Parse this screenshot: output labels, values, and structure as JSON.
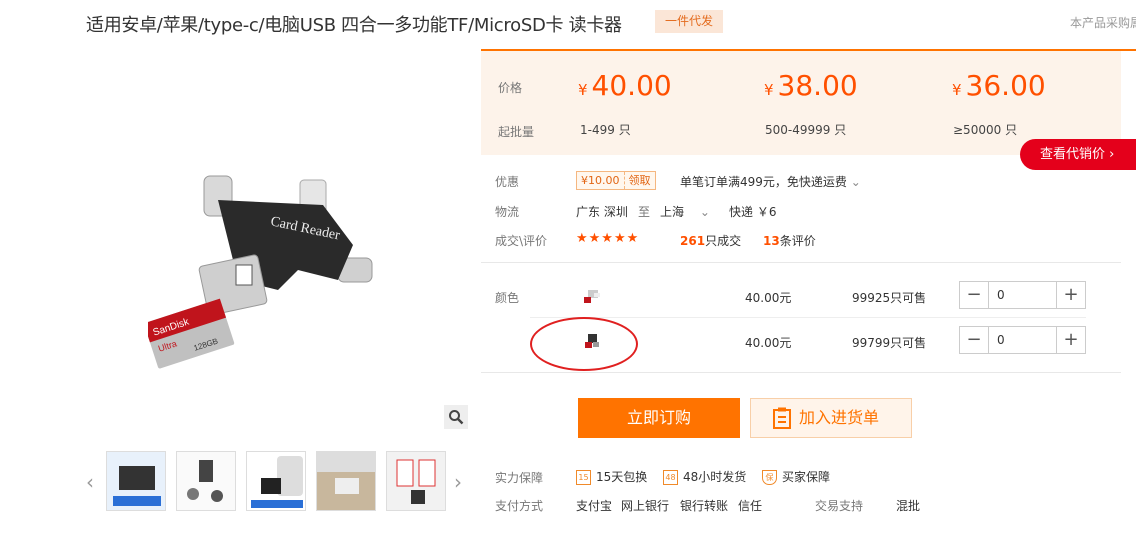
{
  "header": {
    "title": "适用安卓/苹果/type-c/电脑USB 四合一多功能TF/MicroSD卡 读卡器",
    "badge": "一件代发",
    "top_right": "本产品采购属"
  },
  "pricing": {
    "price_label": "价格",
    "moq_label": "起批量",
    "currency": "¥",
    "tiers": [
      {
        "price": "40.00",
        "range": "1-499",
        "unit": "只"
      },
      {
        "price": "38.00",
        "range": "500-49999",
        "unit": "只"
      },
      {
        "price": "36.00",
        "range": "≥50000",
        "unit": "只"
      }
    ],
    "agent_button": "查看代销价"
  },
  "info": {
    "discount_label": "优惠",
    "coupon_amount": "¥10.00",
    "coupon_action": "领取",
    "discount_text": "单笔订单满499元，免快递运费",
    "logistics_label": "物流",
    "from": "广东 深圳",
    "to_word": "至",
    "to": "上海",
    "shipping": "快递 ￥6",
    "review_label": "成交\\评价",
    "stars": "★★★★★",
    "deals_count": "261",
    "deals_text": "只成交",
    "review_count": "13",
    "review_text": "条评价"
  },
  "sku": {
    "color_label": "颜色",
    "items": [
      {
        "price": "40.00元",
        "stock": "99925只可售",
        "qty": "0"
      },
      {
        "price": "40.00元",
        "stock": "99799只可售",
        "qty": "0"
      }
    ]
  },
  "actions": {
    "buy": "立即订购",
    "add_cart": "加入进货单"
  },
  "guarantee": {
    "label": "实力保障",
    "items": [
      "15天包换",
      "48小时发货",
      "买家保障"
    ],
    "payment_label": "支付方式",
    "payment_methods": [
      "支付宝",
      "网上银行",
      "银行转账",
      "信任"
    ],
    "trade_label": "交易支持",
    "trade_value": "混批"
  },
  "product_image": {
    "card_brand": "SanDisk",
    "card_model": "Ultra",
    "card_size": "128GB",
    "reader_text": "Card Reader"
  },
  "colors": {
    "accent": "#ff7300",
    "price": "#ff5000",
    "agent": "#e4001b"
  }
}
